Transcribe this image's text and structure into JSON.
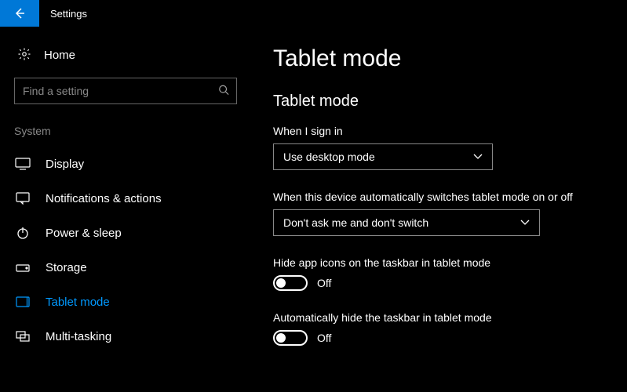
{
  "titlebar": {
    "title": "Settings"
  },
  "sidebar": {
    "home_label": "Home",
    "search_placeholder": "Find a setting",
    "group_label": "System",
    "items": [
      {
        "label": "Display"
      },
      {
        "label": "Notifications & actions"
      },
      {
        "label": "Power & sleep"
      },
      {
        "label": "Storage"
      },
      {
        "label": "Tablet mode"
      },
      {
        "label": "Multi-tasking"
      }
    ]
  },
  "main": {
    "page_title": "Tablet mode",
    "section_title": "Tablet mode",
    "sign_in": {
      "label": "When I sign in",
      "value": "Use desktop mode"
    },
    "auto_switch": {
      "label": "When this device automatically switches tablet mode on or off",
      "value": "Don't ask me and don't switch"
    },
    "hide_icons": {
      "label": "Hide app icons on the taskbar in tablet mode",
      "state": "Off"
    },
    "auto_hide_taskbar": {
      "label": "Automatically hide the taskbar in tablet mode",
      "state": "Off"
    }
  }
}
